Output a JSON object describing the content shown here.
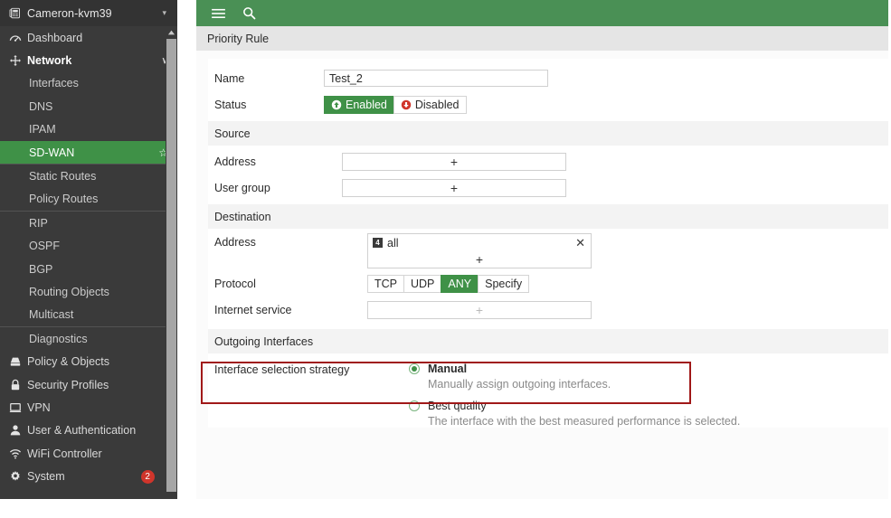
{
  "sidebar": {
    "device": {
      "name": "Cameron-kvm39",
      "icon": "device-icon",
      "caret": "▾"
    },
    "items": [
      {
        "label": "Dashboard",
        "icon": "dashboard-icon",
        "level": "top",
        "arrow": "›"
      },
      {
        "label": "Network",
        "icon": "network-icon",
        "level": "top",
        "arrow": "∨",
        "expanded": true
      },
      {
        "label": "Interfaces",
        "level": "sub"
      },
      {
        "label": "DNS",
        "level": "sub"
      },
      {
        "label": "IPAM",
        "level": "sub"
      },
      {
        "label": "SD-WAN",
        "level": "sub",
        "selected": true,
        "star": "☆"
      },
      {
        "label": "Static Routes",
        "level": "sub",
        "separator_before": true
      },
      {
        "label": "Policy Routes",
        "level": "sub"
      },
      {
        "label": "RIP",
        "level": "sub",
        "separator_before": true
      },
      {
        "label": "OSPF",
        "level": "sub"
      },
      {
        "label": "BGP",
        "level": "sub"
      },
      {
        "label": "Routing Objects",
        "level": "sub"
      },
      {
        "label": "Multicast",
        "level": "sub"
      },
      {
        "label": "Diagnostics",
        "level": "sub",
        "separator_before": true
      },
      {
        "label": "Policy & Objects",
        "icon": "policy-icon",
        "level": "top",
        "arrow": "›"
      },
      {
        "label": "Security Profiles",
        "icon": "lock-icon",
        "level": "top",
        "arrow": "›"
      },
      {
        "label": "VPN",
        "icon": "monitor-icon",
        "level": "top",
        "arrow": "›"
      },
      {
        "label": "User & Authentication",
        "icon": "user-icon",
        "level": "top",
        "arrow": "›"
      },
      {
        "label": "WiFi Controller",
        "icon": "wifi-icon",
        "level": "top",
        "arrow": "›"
      },
      {
        "label": "System",
        "icon": "gear-icon",
        "level": "top",
        "arrow": "›",
        "badge": "2"
      }
    ],
    "scroll_up_arrow": "▲"
  },
  "topbar": {
    "menu_icon": "hamburger-icon",
    "search_icon": "search-icon"
  },
  "page": {
    "title": "Priority Rule"
  },
  "form": {
    "name_label": "Name",
    "name_value": "Test_2",
    "status_label": "Status",
    "status_options": [
      {
        "label": "Enabled",
        "icon": "arrow-up-circle-icon",
        "selected": true
      },
      {
        "label": "Disabled",
        "icon": "arrow-down-circle-icon",
        "selected": false
      }
    ],
    "source": {
      "heading": "Source",
      "address_label": "Address",
      "address_add": "+",
      "usergroup_label": "User group",
      "usergroup_add": "+"
    },
    "destination": {
      "heading": "Destination",
      "address_label": "Address",
      "address_tokens": [
        {
          "icon": "ipv4-address-icon",
          "icon_text": "4",
          "name": "all",
          "remove": "✕"
        }
      ],
      "address_add": "+",
      "protocol_label": "Protocol",
      "protocol_options": [
        {
          "label": "TCP",
          "selected": false
        },
        {
          "label": "UDP",
          "selected": false
        },
        {
          "label": "ANY",
          "selected": true
        },
        {
          "label": "Specify",
          "selected": false
        }
      ],
      "internet_service_label": "Internet service",
      "internet_service_add": "+"
    },
    "outgoing": {
      "heading": "Outgoing Interfaces",
      "strategy_label": "Interface selection strategy",
      "strategies": [
        {
          "title": "Manual",
          "description": "Manually assign outgoing interfaces.",
          "selected": true,
          "highlighted": true
        },
        {
          "title": "Best quality",
          "description": "The interface with the best measured performance is selected.",
          "selected": false,
          "highlighted": false
        }
      ]
    }
  },
  "colors": {
    "accent_green": "#3f9147",
    "toolbar_green": "#4a9055",
    "sidebar_dark": "#3a3a3a",
    "badge_red": "#d0352b",
    "highlight_red": "#a01818"
  }
}
